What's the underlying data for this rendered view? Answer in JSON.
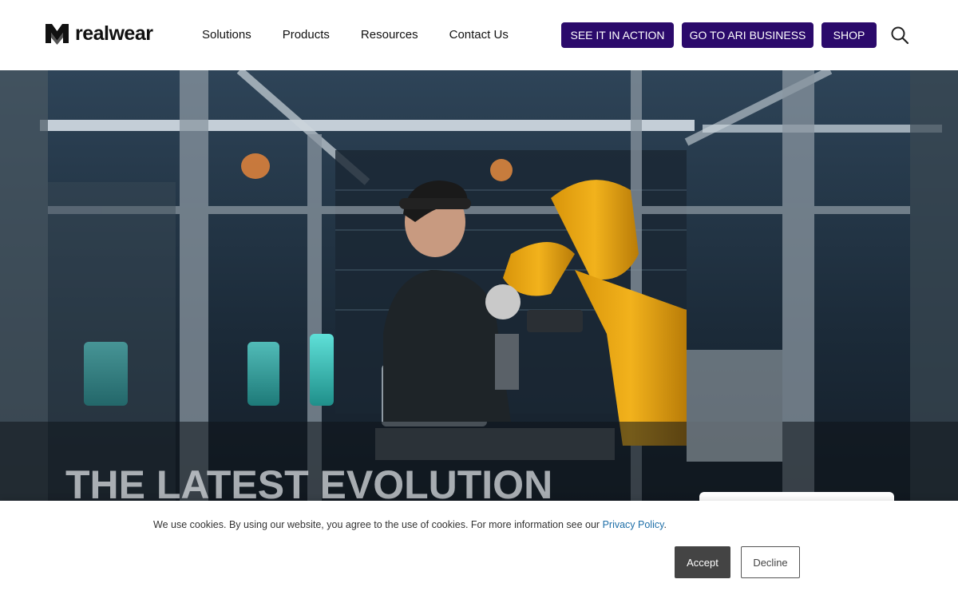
{
  "brand": {
    "name": "realwear"
  },
  "nav": {
    "items": [
      {
        "label": "Solutions"
      },
      {
        "label": "Products"
      },
      {
        "label": "Resources"
      },
      {
        "label": "Contact Us"
      }
    ]
  },
  "cta": {
    "see_it": "SEE IT IN ACTION",
    "ari": "GO TO ARI BUSINESS",
    "shop": "SHOP"
  },
  "icons": {
    "search": "search-icon",
    "logo": "realwear-logo-icon"
  },
  "hero": {
    "title": "THE LATEST EVOLUTION"
  },
  "cookie": {
    "text": "We use cookies. By using our website, you agree to the use of cookies. For more information see our ",
    "link": "Privacy Policy",
    "period": ".",
    "accept": "Accept",
    "decline": "Decline"
  },
  "colors": {
    "brand_purple": "#2b0a6b",
    "accept_bg": "#444444",
    "link": "#1e6fa8"
  }
}
